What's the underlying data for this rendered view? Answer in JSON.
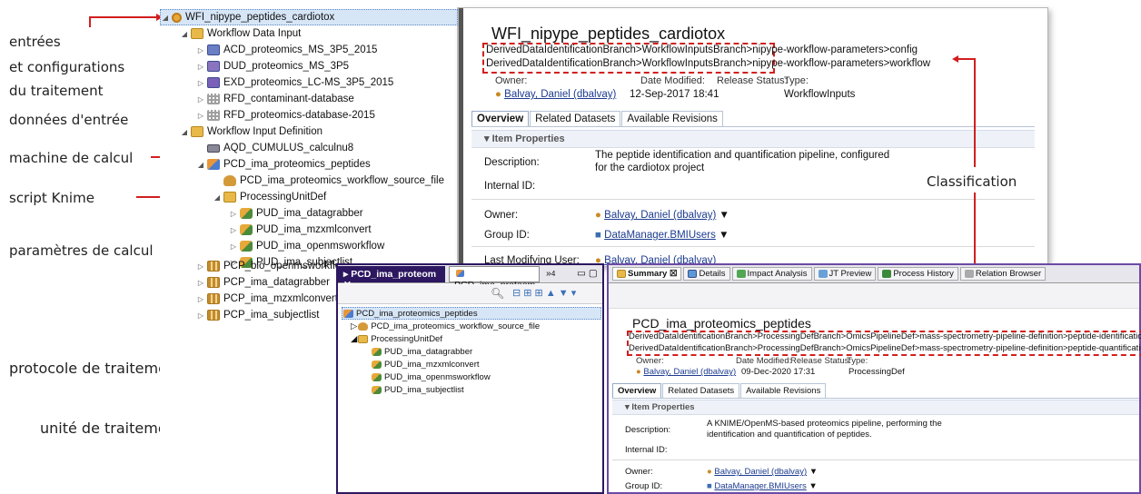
{
  "annotations": {
    "inputs_config": [
      "entrées",
      "et configurations",
      "du traitement"
    ],
    "input_data": "données d'entrée",
    "machine": "machine de calcul",
    "script": "script Knime",
    "params": "paramètres de calcul",
    "classification": "Classification",
    "pcd": "protocole de traitement (PCD)",
    "pud": "unité de traitement (PUD)"
  },
  "tree": {
    "root": "WFI_nipype_peptides_cardiotox",
    "items": [
      "Workflow Data Input",
      "ACD_proteomics_MS_3P5_2015",
      "DUD_proteomics_MS_3P5",
      "EXD_proteomics_LC-MS_3P5_2015",
      "RFD_contaminant-database",
      "RFD_proteomics-database-2015",
      "Workflow Input Definition",
      "AQD_CUMULUS_calculnu8",
      "PCD_ima_proteomics_peptides",
      "PCD_ima_proteomics_workflow_source_file",
      "ProcessingUnitDef",
      "PUD_ima_datagrabber",
      "PUD_ima_mzxmlconvert",
      "PUD_ima_openmsworkflow",
      "PUD_ima_subjectlist",
      "PCP_bio_openmsworkflow",
      "PCP_ima_datagrabber",
      "PCP_ima_mzxmlconvert",
      "PCP_ima_subjectlist"
    ]
  },
  "panel1": {
    "title": "WFI_nipype_peptides_cardiotox",
    "class_line1": "DerivedDataIdentificationBranch>WorkflowInputsBranch>nipype-workflow-parameters>config",
    "class_line2": "DerivedDataIdentificationBranch>WorkflowInputsBranch>nipype-workflow-parameters>workflow",
    "owner_h": "Owner:",
    "date_h": "Date Modified:",
    "release_h": "Release Status:",
    "type_h": "Type:",
    "owner": "Balvay, Daniel (dbalvay)",
    "date": "12-Sep-2017 18:41",
    "type": "WorkflowInputs",
    "tabs": [
      "Overview",
      "Related Datasets",
      "Available Revisions"
    ],
    "section": "Item Properties",
    "desc_label": "Description:",
    "desc1": "The peptide identification and quantification pipeline, configured",
    "desc2": "for the cardiotox project",
    "internal_id": "Internal ID:",
    "owner_label": "Owner:",
    "owner_val": "Balvay, Daniel (dbalvay)",
    "group_label": "Group ID:",
    "group_val": "DataManager.BMIUsers",
    "lmu_label": "Last Modifying User:",
    "lmu_val": "Balvay, Daniel (dbalvay)"
  },
  "panel2": {
    "tabs": [
      "PCD_ima_proteom",
      "PCD_ima_proteom",
      "»",
      "4"
    ],
    "items": [
      "PCD_ima_proteomics_peptides",
      "PCD_ima_proteomics_workflow_source_file",
      "ProcessingUnitDef",
      "PUD_ima_datagrabber",
      "PUD_ima_mzxmlconvert",
      "PUD_ima_openmsworkflow",
      "PUD_ima_subjectlist"
    ]
  },
  "panel3": {
    "tabs": [
      "Summary",
      "Details",
      "Impact Analysis",
      "JT Preview",
      "Process History",
      "Relation Browser"
    ],
    "title": "PCD_ima_proteomics_peptides",
    "class_line1": "DerivedDataIdentificationBranch>ProcessingDefBranch>OmicsPipelineDef>mass-spectrometry-pipeline-definition>peptide-identification",
    "class_line2": "DerivedDataIdentificationBranch>ProcessingDefBranch>OmicsPipelineDef>mass-spectrometry-pipeline-definition>peptide-quantification",
    "owner_h": "Owner:",
    "date_h": "Date Modified:",
    "release_h": "Release Status:",
    "type_h": "Type:",
    "owner": "Balvay, Daniel (dbalvay)",
    "date": "09-Dec-2020 17:31",
    "type": "ProcessingDef",
    "tabs2": [
      "Overview",
      "Related Datasets",
      "Available Revisions"
    ],
    "section": "Item Properties",
    "desc_label": "Description:",
    "desc1": "A KNIME/OpenMS-based proteomics pipeline, performing the",
    "desc2": "identification and  quantification of peptides.",
    "internal_id": "Internal ID:",
    "owner_label": "Owner:",
    "owner_val": "Balvay, Daniel (dbalvay)",
    "group_label": "Group ID:",
    "group_val": "DataManager.BMIUsers"
  },
  "colors": {
    "accent": "#d21f1f",
    "selection": "#d7e6f7",
    "dark_tab": "#2c1760"
  }
}
